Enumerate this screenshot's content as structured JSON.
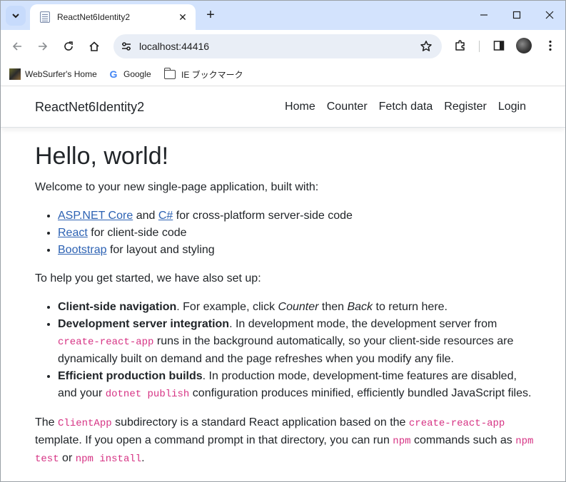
{
  "browser": {
    "tab_title": "ReactNet6Identity2",
    "url": "localhost:44416",
    "bookmarks": [
      {
        "label": "WebSurfer's Home"
      },
      {
        "label": "Google"
      },
      {
        "label": "IE ブックマーク"
      }
    ]
  },
  "navbar": {
    "brand": "ReactNet6Identity2",
    "links": [
      "Home",
      "Counter",
      "Fetch data",
      "Register",
      "Login"
    ]
  },
  "content": {
    "heading": "Hello, world!",
    "intro": "Welcome to your new single-page application, built with:",
    "built_with": [
      {
        "link1": "ASP.NET Core",
        "and": "and",
        "link2": "C#",
        "rest": "for cross-platform server-side code"
      },
      {
        "link1": "React",
        "rest": "for client-side code"
      },
      {
        "link1": "Bootstrap",
        "rest": "for layout and styling"
      }
    ],
    "setup_intro": "To help you get started, we have also set up:",
    "features": [
      {
        "title": "Client-side navigation",
        "t1": ". For example, click ",
        "em1": "Counter",
        "t2": " then ",
        "em2": "Back",
        "t3": " to return here."
      },
      {
        "title": "Development server integration",
        "t1": ". In development mode, the development server from ",
        "code1": "create-react-app",
        "t2": " runs in the background automatically, so your client-side resources are dynamically built on demand and the page refreshes when you modify any file."
      },
      {
        "title": "Efficient production builds",
        "t1": ". In production mode, development-time features are disabled, and your ",
        "code1": "dotnet publish",
        "t2": " configuration produces minified, efficiently bundled JavaScript files."
      }
    ],
    "footer": {
      "t1": "The ",
      "code1": "ClientApp",
      "t2": " subdirectory is a standard React application based on the ",
      "code2": "create-react-app",
      "t3": " template. If you open a command prompt in that directory, you can run ",
      "code3": "npm",
      "t4": " commands such as ",
      "code4": "npm test",
      "t5": " or ",
      "code5": "npm install",
      "t6": "."
    }
  },
  "colors": {
    "tabstrip": "#d3e3fd",
    "link": "#2d62b3",
    "code": "#d63384"
  }
}
